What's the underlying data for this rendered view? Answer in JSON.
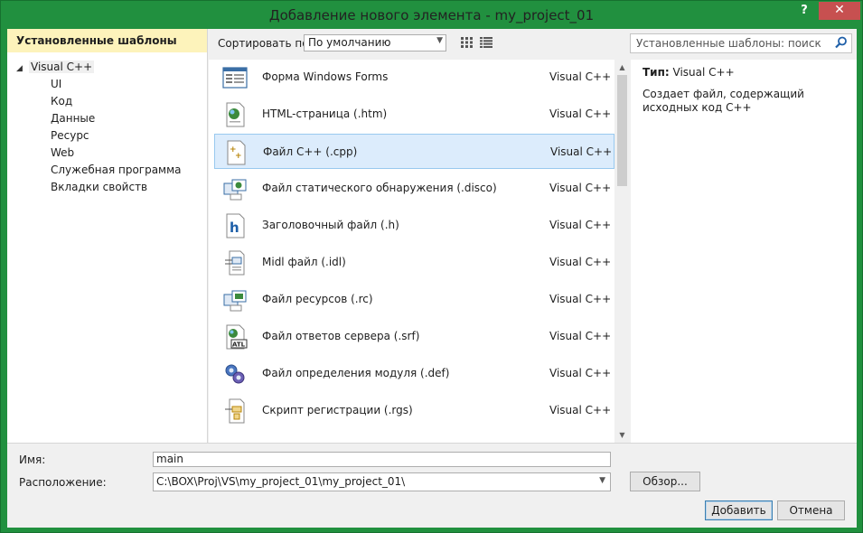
{
  "window": {
    "title": "Добавление нового элемента - my_project_01",
    "help": "?",
    "close": "✕"
  },
  "left": {
    "header": "Установленные шаблоны",
    "root": "Visual C++",
    "children": [
      "UI",
      "Код",
      "Данные",
      "Ресурс",
      "Web",
      "Служебная программа",
      "Вкладки свойств"
    ]
  },
  "toolbar": {
    "sort_label": "Сортировать по:",
    "sort_value": "По умолчанию",
    "search_placeholder": "Установленные шаблоны: поиск"
  },
  "items": [
    {
      "name": "Форма Windows Forms",
      "lang": "Visual C++",
      "icon": "form-icon"
    },
    {
      "name": "HTML-страница (.htm)",
      "lang": "Visual C++",
      "icon": "html-page-icon"
    },
    {
      "name": "Файл C++ (.cpp)",
      "lang": "Visual C++",
      "icon": "cpp-file-icon"
    },
    {
      "name": "Файл статического обнаружения (.disco)",
      "lang": "Visual C++",
      "icon": "disco-file-icon"
    },
    {
      "name": "Заголовочный файл (.h)",
      "lang": "Visual C++",
      "icon": "header-file-icon"
    },
    {
      "name": "Midl файл (.idl)",
      "lang": "Visual C++",
      "icon": "idl-file-icon"
    },
    {
      "name": "Файл ресурсов (.rc)",
      "lang": "Visual C++",
      "icon": "rc-file-icon"
    },
    {
      "name": "Файл ответов сервера (.srf)",
      "lang": "Visual C++",
      "icon": "srf-file-icon"
    },
    {
      "name": "Файл определения модуля (.def)",
      "lang": "Visual C++",
      "icon": "def-file-icon"
    },
    {
      "name": "Скрипт регистрации (.rgs)",
      "lang": "Visual C++",
      "icon": "rgs-file-icon"
    }
  ],
  "selected_index": 2,
  "details": {
    "type_key": "Тип:",
    "type_value": "Visual C++",
    "description": "Создает файл, содержащий исходных код C++"
  },
  "form": {
    "name_label": "Имя:",
    "name_value": "main",
    "location_label": "Расположение:",
    "location_value": "C:\\BOX\\Proj\\VS\\my_project_01\\my_project_01\\",
    "browse_label": "Обзор...",
    "add_label": "Добавить",
    "cancel_label": "Отмена"
  },
  "colors": {
    "window_frame": "#21903f",
    "selection": "#dcecfc",
    "header_highlight": "#fdf3bb",
    "close_button": "#c75050"
  }
}
